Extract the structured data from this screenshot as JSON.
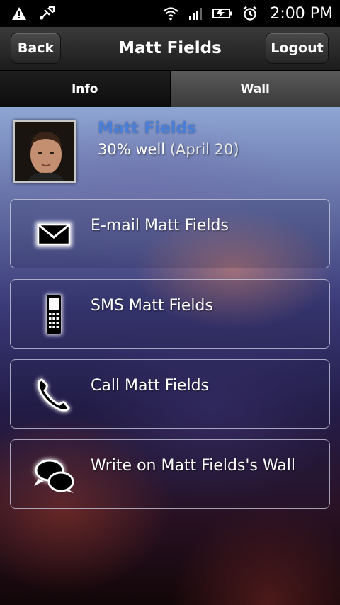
{
  "status_bar": {
    "time": "2:00 PM",
    "icons": [
      "warning-icon",
      "usb-debug-icon",
      "wifi-icon",
      "signal-icon",
      "battery-icon",
      "alarm-icon"
    ]
  },
  "header": {
    "back_label": "Back",
    "title": "Matt Fields",
    "logout_label": "Logout"
  },
  "tabs": [
    {
      "label": "Info",
      "selected": true
    },
    {
      "label": "Wall",
      "selected": false
    }
  ],
  "profile": {
    "name": "Matt Fields",
    "status": "30% well",
    "status_date": "(April 20)"
  },
  "actions": [
    {
      "label": "E-mail Matt Fields",
      "icon": "envelope-icon"
    },
    {
      "label": "SMS Matt Fields",
      "icon": "mobile-phone-icon"
    },
    {
      "label": "Call Matt Fields",
      "icon": "phone-handset-icon"
    },
    {
      "label": "Write on Matt Fields's Wall",
      "icon": "chat-bubbles-icon"
    }
  ],
  "colors": {
    "profile_name": "#4a7fd8",
    "title_bar": "#2a2a2a",
    "tab_selected": "#151515",
    "tab_unselected": "#4a4a4a"
  }
}
